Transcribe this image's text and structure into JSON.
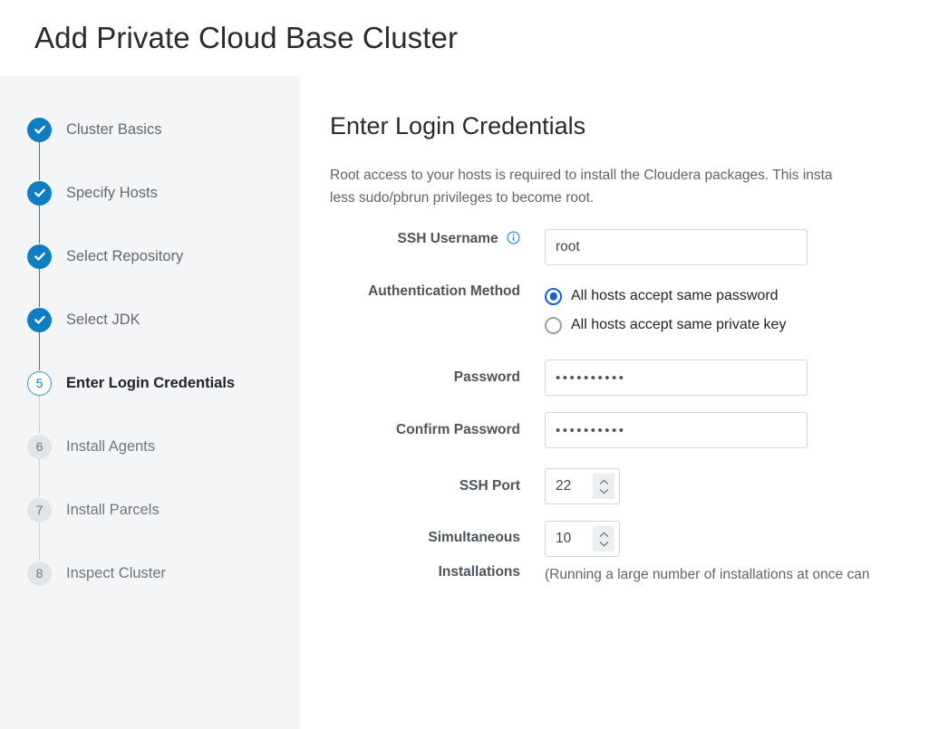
{
  "header": {
    "title": "Add Private Cloud Base Cluster"
  },
  "wizard": {
    "steps": [
      {
        "number": "1",
        "label": "Cluster Basics",
        "state": "done"
      },
      {
        "number": "2",
        "label": "Specify Hosts",
        "state": "done"
      },
      {
        "number": "3",
        "label": "Select Repository",
        "state": "done"
      },
      {
        "number": "4",
        "label": "Select JDK",
        "state": "done"
      },
      {
        "number": "5",
        "label": "Enter Login Credentials",
        "state": "current"
      },
      {
        "number": "6",
        "label": "Install Agents",
        "state": "pending"
      },
      {
        "number": "7",
        "label": "Install Parcels",
        "state": "pending"
      },
      {
        "number": "8",
        "label": "Inspect Cluster",
        "state": "pending"
      }
    ]
  },
  "main": {
    "title": "Enter Login Credentials",
    "description": "Root access to your hosts is required to install the Cloudera packages. This insta\nless sudo/pbrun privileges to become root.",
    "form": {
      "ssh_username": {
        "label": "SSH Username",
        "info_icon": "info-circle-icon",
        "value": "root",
        "placeholder": ""
      },
      "authentication_method": {
        "label": "Authentication Method",
        "options": [
          {
            "label": "All hosts accept same password",
            "selected": true
          },
          {
            "label": "All hosts accept same private key",
            "selected": false
          }
        ]
      },
      "password": {
        "label": "Password",
        "masked_value": "••••••••••"
      },
      "confirm_password": {
        "label": "Confirm Password",
        "masked_value": "••••••••••"
      },
      "ssh_port": {
        "label": "SSH Port",
        "value": "22",
        "stepper_icon": "updown-chevron-icon"
      },
      "simultaneous_installations": {
        "label_line1": "Simultaneous",
        "label_line2": "Installations",
        "value": "10",
        "stepper_icon": "updown-chevron-icon",
        "hint": "(Running a large number of installations at once can"
      }
    }
  },
  "colors": {
    "accent_blue": "#0f7dc2",
    "radio_blue": "#1560d4",
    "page_background": "#f3f5f6",
    "card_background": "#ffffff",
    "label_text": "#4c545c",
    "muted_text": "#6f767d"
  }
}
